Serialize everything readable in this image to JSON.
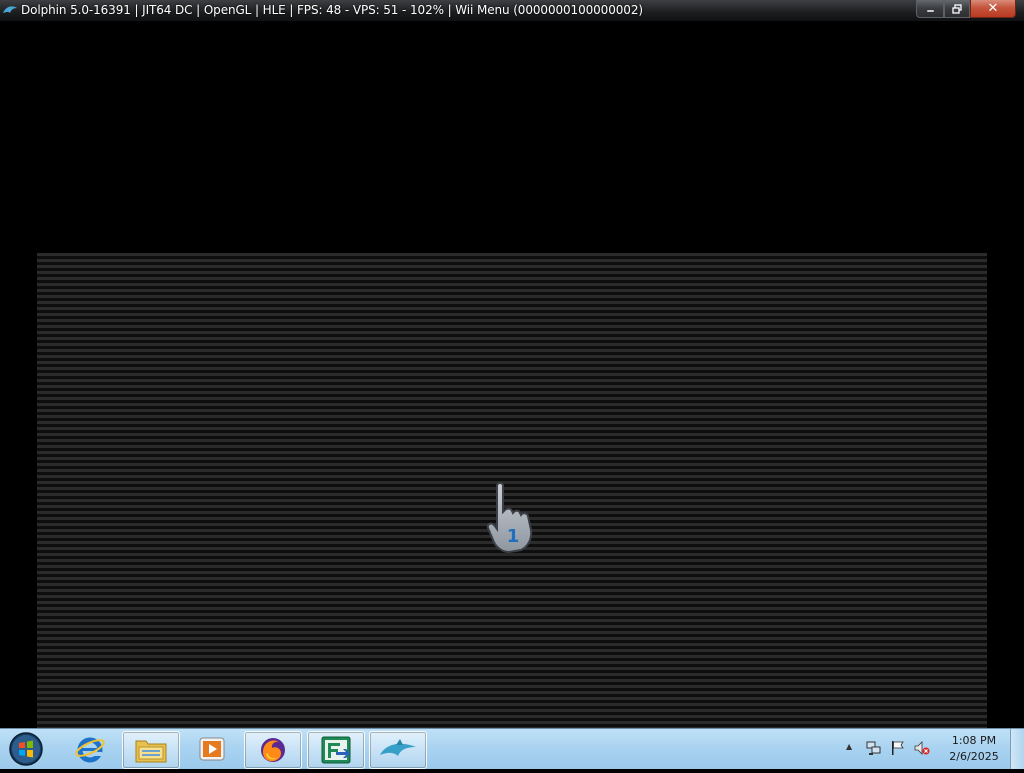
{
  "window": {
    "title": "Dolphin 5.0-16391 | JIT64 DC | OpenGL | HLE | FPS: 48 - VPS: 51 - 102% | Wii Menu (0000000100000002)",
    "minimize_icon": "minimize-icon",
    "maximize_icon": "restore-icon",
    "close_label": "✕"
  },
  "game": {
    "pointer_number": "1",
    "pointer_icon": "wii-pointer-hand-icon"
  },
  "taskbar": {
    "start_icon": "windows-start-orb-icon",
    "buttons": [
      {
        "name": "internet-explorer",
        "icon": "ie-icon"
      },
      {
        "name": "file-explorer",
        "icon": "folder-icon"
      },
      {
        "name": "media-player",
        "icon": "media-player-icon"
      },
      {
        "name": "firefox",
        "icon": "firefox-icon"
      },
      {
        "name": "app-f",
        "icon": "f-app-icon"
      },
      {
        "name": "dolphin",
        "icon": "dolphin-icon"
      }
    ],
    "tray": {
      "chevron": "▲",
      "time": "1:08 PM",
      "date": "2/6/2025"
    }
  },
  "colors": {
    "taskbar": "#a8d2f0",
    "ie_blue": "#1e73c8",
    "dolphin_teal": "#37a0c8"
  }
}
